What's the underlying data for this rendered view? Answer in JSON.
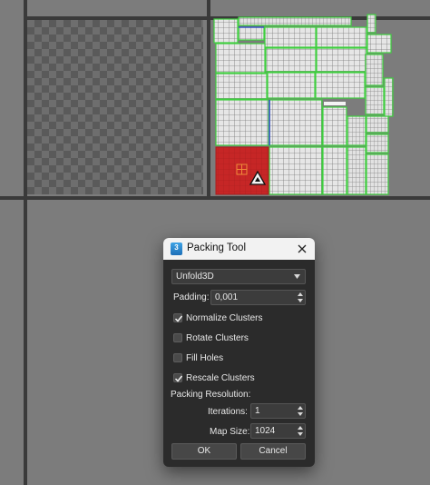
{
  "dialog": {
    "title": "Packing Tool",
    "app_icon_text": "3",
    "method": {
      "selected": "Unfold3D"
    },
    "padding": {
      "label": "Padding:",
      "value": "0,001"
    },
    "options": [
      {
        "label": "Normalize Clusters",
        "checked": true
      },
      {
        "label": "Rotate Clusters",
        "checked": false
      },
      {
        "label": "Fill Holes",
        "checked": false
      },
      {
        "label": "Rescale Clusters",
        "checked": true
      }
    ],
    "packing_resolution_label": "Packing Resolution:",
    "iterations": {
      "label": "Iterations:",
      "value": "1"
    },
    "map_size": {
      "label": "Map Size:",
      "value": "1024"
    },
    "ok_label": "OK",
    "cancel_label": "Cancel"
  },
  "colors": {
    "accent_green": "#3ecf3e",
    "selection_red": "#c62626",
    "viewport_bg": "#7c7c7c"
  }
}
